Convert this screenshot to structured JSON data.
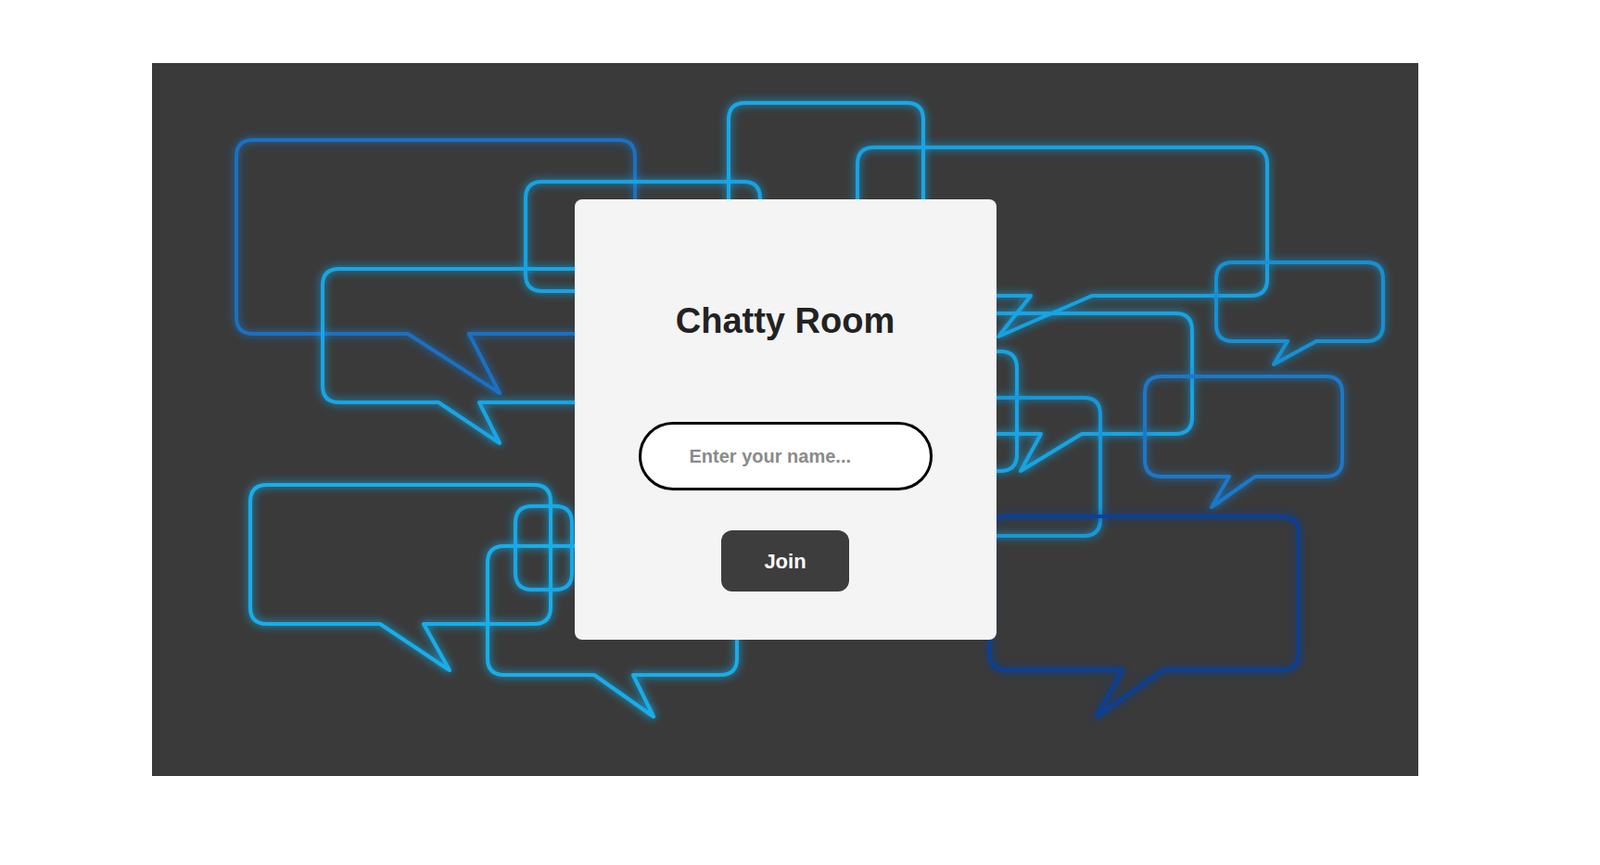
{
  "title": "Chatty Room",
  "name_field": {
    "placeholder": "Enter your name..."
  },
  "join_button": {
    "label": "Join"
  }
}
